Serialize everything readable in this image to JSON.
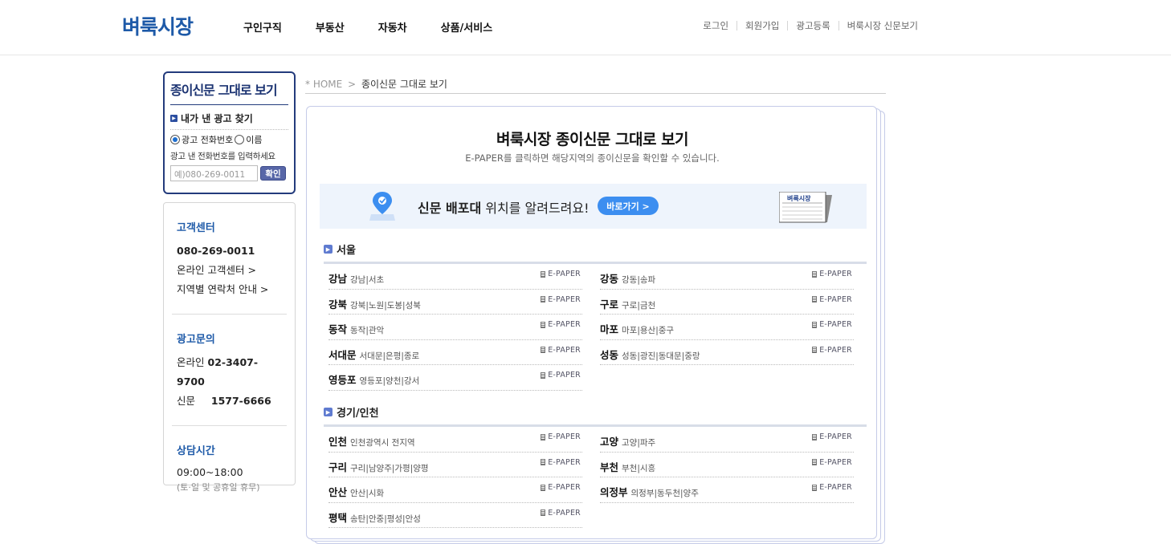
{
  "header": {
    "logo": "벼룩시장",
    "nav": [
      "구인구직",
      "부동산",
      "자동차",
      "상품/서비스"
    ],
    "util": [
      "로그인",
      "회원가입",
      "광고등록",
      "벼룩시장 신문보기"
    ]
  },
  "paper_search": {
    "title": "종이신문 그대로 보기",
    "subtitle": "내가 낸 광고 찾기",
    "radio_phone": "광고 전화번호",
    "radio_name": "이름",
    "hint": "광고 낸 전화번호를 입력하세요",
    "input_placeholder": "예)080-269-0011",
    "confirm": "확인"
  },
  "customer_center": {
    "title": "고객센터",
    "phone": "080-269-0011",
    "online": "온라인 고객센터 >",
    "regional": "지역별 연락처 안내 >"
  },
  "ad_inquiry": {
    "title": "광고문의",
    "online_label": "온라인",
    "online_phone": "02-3407-9700",
    "paper_label": "신문",
    "paper_phone": "1577-6666"
  },
  "hours": {
    "title": "상담시간",
    "time": "09:00~18:00",
    "note": "(토·일 및 공휴일 휴무)"
  },
  "breadcrumb": {
    "home": "* HOME",
    "sep": ">",
    "current": "종이신문 그대로 보기"
  },
  "main": {
    "title": "벼룩시장 종이신문 그대로 보기",
    "desc": "E-PAPER를 클릭하면 해당지역의 종이신문을 확인할 수 있습니다.",
    "banner_bold": "신문 배포대",
    "banner_rest": " 위치를 알려드려요!",
    "banner_btn": "바로가기 >",
    "news_icon_label": "벼룩시장",
    "epaper_label": "E-PAPER"
  },
  "regions": [
    {
      "name": "서울",
      "left": [
        {
          "name": "강남",
          "areas": "강남|서초"
        },
        {
          "name": "강북",
          "areas": "강북|노원|도봉|성북"
        },
        {
          "name": "동작",
          "areas": "동작|관악"
        },
        {
          "name": "서대문",
          "areas": "서대문|은평|종로"
        },
        {
          "name": "영등포",
          "areas": "영등포|양천|강서"
        }
      ],
      "right": [
        {
          "name": "강동",
          "areas": "강동|송파"
        },
        {
          "name": "구로",
          "areas": "구로|금천"
        },
        {
          "name": "마포",
          "areas": "마포|용산|중구"
        },
        {
          "name": "성동",
          "areas": "성동|광진|동대문|중랑"
        }
      ]
    },
    {
      "name": "경기/인천",
      "left": [
        {
          "name": "인천",
          "areas": "인천광역시 전지역"
        },
        {
          "name": "구리",
          "areas": "구리|남양주|가평|양평"
        },
        {
          "name": "안산",
          "areas": "안산|시화"
        },
        {
          "name": "평택",
          "areas": "송탄|안중|평성|안성"
        }
      ],
      "right": [
        {
          "name": "고양",
          "areas": "고양|파주"
        },
        {
          "name": "부천",
          "areas": "부천|시흥"
        },
        {
          "name": "의정부",
          "areas": "의정부|동두천|양주"
        }
      ]
    }
  ]
}
